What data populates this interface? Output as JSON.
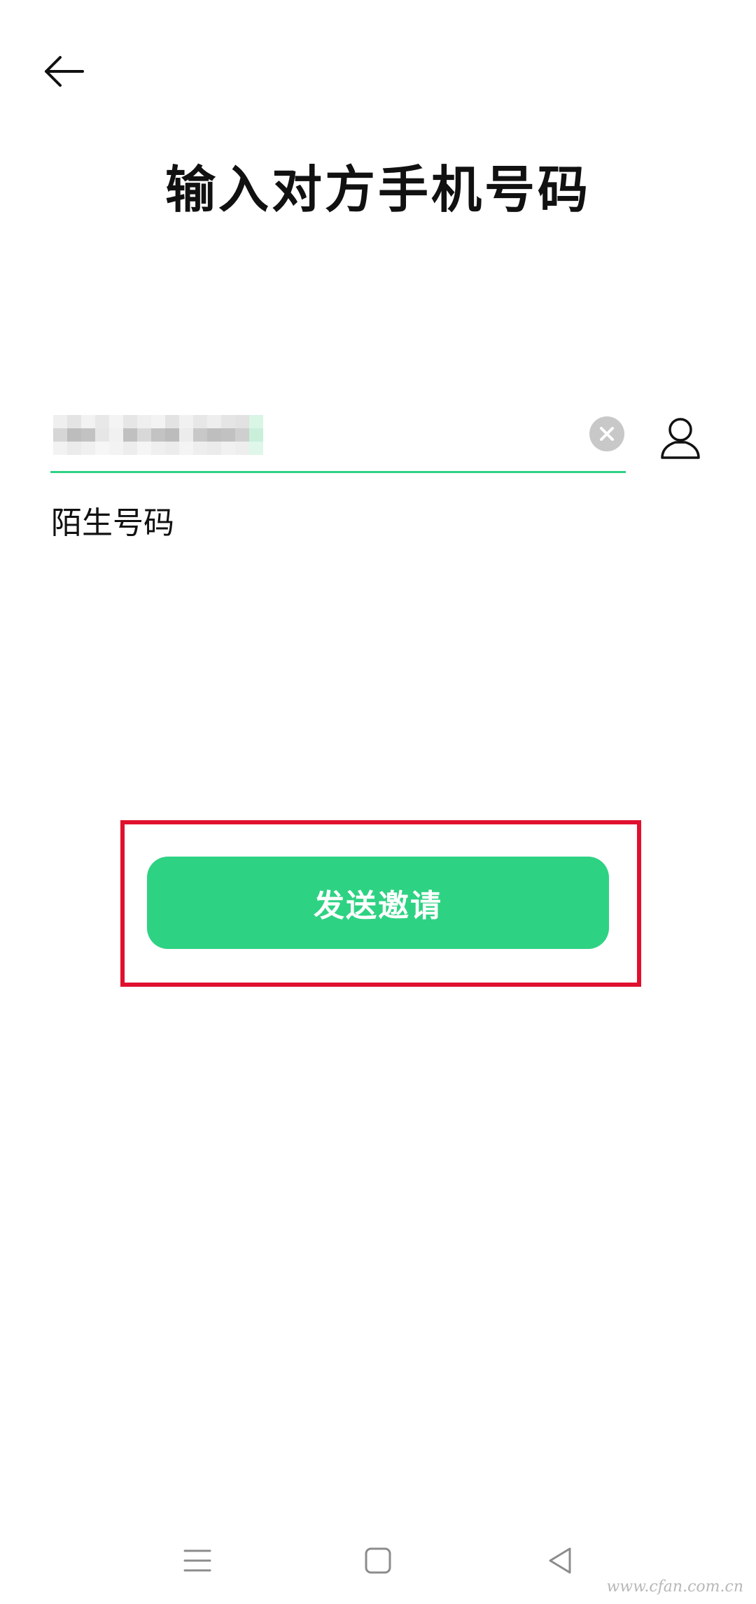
{
  "title": "输入对方手机号码",
  "phone_field": {
    "value_hidden": true
  },
  "hint": "陌生号码",
  "send_button": {
    "label": "发送邀请"
  },
  "watermark": "www.cfan.com.cn",
  "colors": {
    "accent": "#2ED283",
    "highlight_border": "#E0102E",
    "background": "#FFFFFF"
  },
  "icons": {
    "back": "arrow-left-icon",
    "clear": "clear-circle-icon",
    "contacts": "person-icon",
    "nav_menu": "menu-icon",
    "nav_home": "home-icon",
    "nav_back": "back-triangle-icon"
  }
}
